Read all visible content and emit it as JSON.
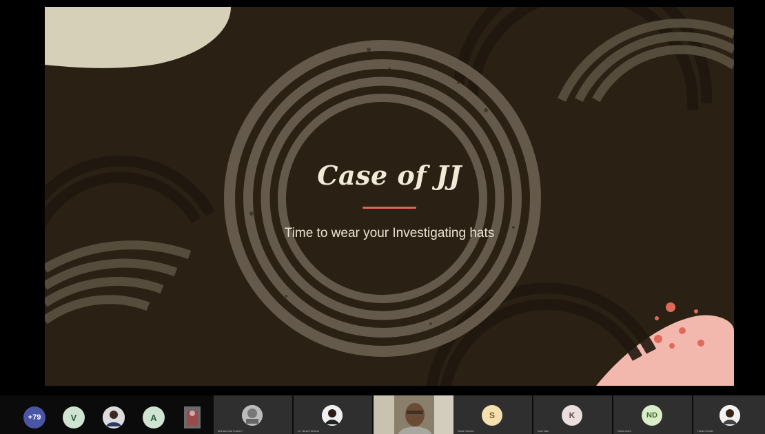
{
  "slide": {
    "title": "Case of JJ",
    "subtitle": "Time to wear your Investigating hats"
  },
  "participants": {
    "more_count": "+79",
    "small": [
      {
        "initial": "V",
        "color": "#cfe3d3",
        "text_color": "#2d5a3a"
      },
      {
        "kind": "photo",
        "icon": "user-photo"
      },
      {
        "initial": "A",
        "color": "#cfe3d3",
        "text_color": "#2d5a3a"
      },
      {
        "kind": "photo",
        "icon": "user-photo"
      }
    ],
    "tiles": [
      {
        "initial": "",
        "icon": "user-photo",
        "name": "Muhammad Ibrahim"
      },
      {
        "initial": "",
        "icon": "user-photo",
        "name": "Dr. Nesa Fathima"
      },
      {
        "initial": "",
        "icon": "video-feed",
        "name": ""
      },
      {
        "initial": "S",
        "color": "#f6dfae",
        "text_color": "#7a5518",
        "name": "Sana Hashim"
      },
      {
        "initial": "K",
        "color": "#eadede",
        "text_color": "#6a4a4a",
        "name": "Kavi Nila"
      },
      {
        "initial": "ND",
        "color": "#d9edc9",
        "text_color": "#3f6a2a",
        "name": "Nisha Dani"
      },
      {
        "initial": "",
        "icon": "user-photo",
        "name": "Hafsa Khalid"
      }
    ]
  },
  "colors": {
    "slide_bg": "#2a2114",
    "accent": "#e0665a",
    "ring": "#6b6050"
  }
}
